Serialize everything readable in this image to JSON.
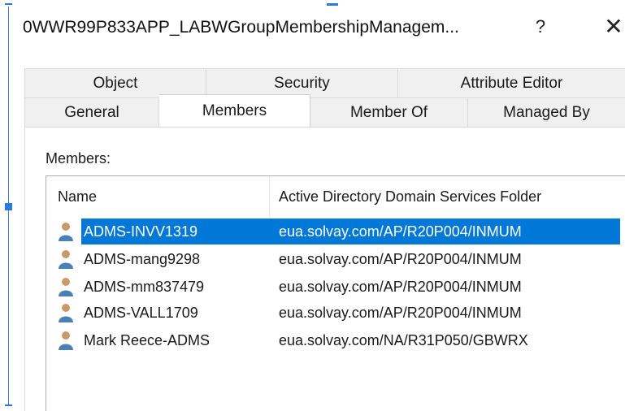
{
  "window": {
    "title": "0WWR99P833APP_LABWGroupMembershipManagem...",
    "help_label": "?",
    "close_label": "✕"
  },
  "tabs": {
    "back_row": [
      {
        "label": "Object"
      },
      {
        "label": "Security"
      },
      {
        "label": "Attribute Editor"
      }
    ],
    "front_row": [
      {
        "label": "General"
      },
      {
        "label": "Members",
        "active": true
      },
      {
        "label": "Member Of"
      },
      {
        "label": "Managed By"
      }
    ]
  },
  "members": {
    "label": "Members:",
    "columns": {
      "name": "Name",
      "folder": "Active Directory Domain Services Folder"
    },
    "rows": [
      {
        "name": "ADMS-INVV1319",
        "folder": "eua.solvay.com/AP/R20P004/INMUM",
        "selected": true
      },
      {
        "name": "ADMS-mang9298",
        "folder": "eua.solvay.com/AP/R20P004/INMUM"
      },
      {
        "name": "ADMS-mm837479",
        "folder": "eua.solvay.com/AP/R20P004/INMUM"
      },
      {
        "name": "ADMS-VALL1709",
        "folder": "eua.solvay.com/AP/R20P004/INMUM"
      },
      {
        "name": "Mark Reece-ADMS",
        "folder": "eua.solvay.com/NA/R31P050/GBWRX"
      }
    ]
  },
  "colors": {
    "selection": "#0078d7",
    "tab_inactive": "#f0f0f0",
    "user_icon_body": "#4a7fb8",
    "user_icon_head": "#c89a6a"
  }
}
